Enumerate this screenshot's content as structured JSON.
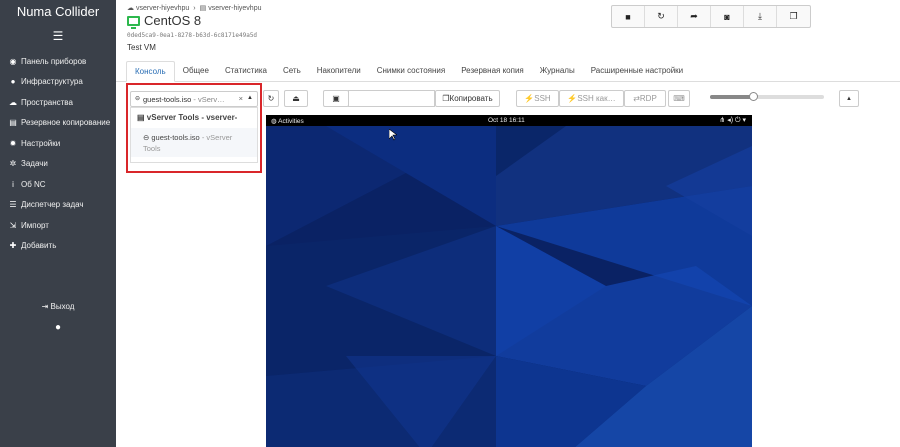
{
  "app": {
    "name": "Numa Collider"
  },
  "sidebar": {
    "items": [
      {
        "label": "Панель приборов",
        "icon": "speedometer-icon",
        "glyph": "◉"
      },
      {
        "label": "Инфраструктура",
        "icon": "globe-icon",
        "glyph": "●"
      },
      {
        "label": "Пространства",
        "icon": "cloud-icon",
        "glyph": "☁"
      },
      {
        "label": "Резервное копирование",
        "icon": "archive-icon",
        "glyph": "▤"
      },
      {
        "label": "Настройки",
        "icon": "gear-icon",
        "glyph": "✹"
      },
      {
        "label": "Задачи",
        "icon": "gears-icon",
        "glyph": "✲"
      },
      {
        "label": "Об NC",
        "icon": "info-icon",
        "glyph": "i"
      },
      {
        "label": "Диспетчер задач",
        "icon": "list-icon",
        "glyph": "☰"
      },
      {
        "label": "Импорт",
        "icon": "import-icon",
        "glyph": "⇲"
      },
      {
        "label": "Добавить",
        "icon": "plus-icon",
        "glyph": "✚"
      }
    ],
    "logout": "Выход"
  },
  "breadcrumb": {
    "pool": "vserver-hiyevhpu",
    "host": "vserver-hiyevhpu"
  },
  "vm": {
    "title": "CentOS 8",
    "uuid": "0ded5ca9-0ea1-8278-b63d-6c8171e49a5d",
    "description": "Test VM"
  },
  "tabs": [
    "Консоль",
    "Общее",
    "Статистика",
    "Сеть",
    "Накопители",
    "Снимки состояния",
    "Резервная копия",
    "Журналы",
    "Расширенные настройки"
  ],
  "console": {
    "iso_selected": "guest-tools.iso",
    "iso_selected_suffix": "- vServ…",
    "dropdown_group": "vServer Tools - vserver-",
    "dropdown_option": "guest-tools.iso",
    "dropdown_option_suffix": "- vServer Tools",
    "copy_label": "Копировать",
    "ssh_label": "SSH",
    "ssh_as_label": "SSH как…",
    "rdp_label": "RDP",
    "scale": 0.38
  },
  "vm_screen": {
    "activities": "Activities",
    "clock": "Oct 18  16:11"
  },
  "colors": {
    "sidebar": "#3a4049",
    "accent": "#2a6eb5",
    "running": "#2db84d",
    "highlight": "#d9262a"
  }
}
